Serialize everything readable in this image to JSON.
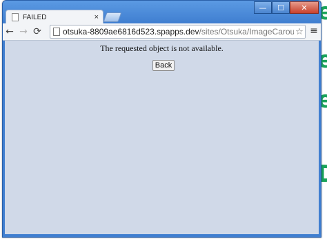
{
  "background": {
    "letters": [
      "e",
      "e",
      "e",
      "D"
    ]
  },
  "window": {
    "tab_title": "FAILED",
    "tab_close": "×",
    "controls": {
      "minimize": "—",
      "maximize": "☐",
      "close": "✕"
    }
  },
  "toolbar": {
    "back_icon": "←",
    "forward_icon": "→",
    "reload_icon": "⟳",
    "url_host": "otsuka-8809ae6816d523.spapps.dev",
    "url_path": "/sites/Otsuka/ImageCarousel/I",
    "star_icon": "☆",
    "menu_icon": "≡"
  },
  "page": {
    "message": "The requested object is not available.",
    "back_button": "Back"
  }
}
